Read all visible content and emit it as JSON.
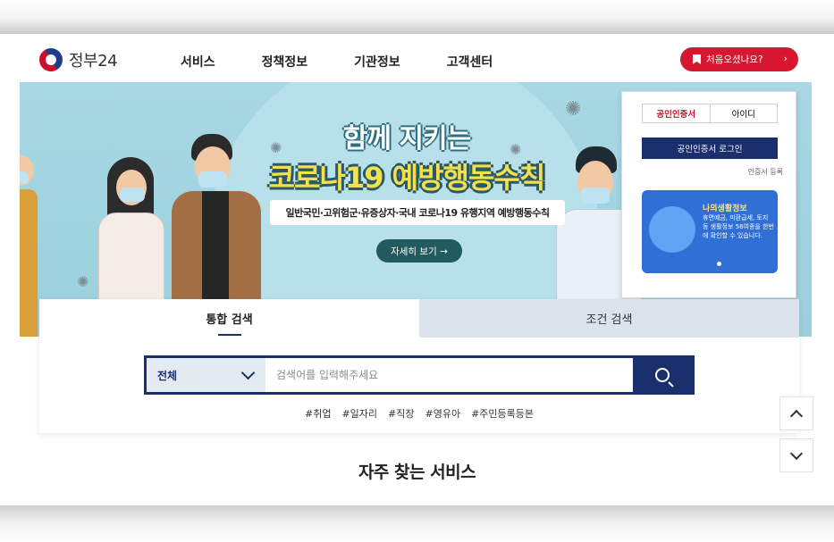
{
  "header": {
    "logo_text": "정부24",
    "nav": [
      "서비스",
      "정책정보",
      "기관정보",
      "고객센터"
    ],
    "first_visit_label": "처음오셨나요?",
    "first_visit_chevron": "›"
  },
  "banner": {
    "title_line1": "함께 지키는",
    "title_line2": "코로나19 예방행동수칙",
    "subtitle": "일반국민·고위험군·유증상자·국내 코로나19 유행지역 예방행동수칙",
    "detail_button": "자세히 보기 →"
  },
  "login": {
    "tabs": [
      "공인인증서",
      "아이디"
    ],
    "login_button": "공인인증서 로그인",
    "cert_register": "인증서 등록",
    "life_info_title": "나의생활정보",
    "life_info_desc": "휴면예금, 미환급세, 토지 등 생활정보 56여종을 한번에 확인할 수 있습니다."
  },
  "search": {
    "tabs": [
      "통합 검색",
      "조건 검색"
    ],
    "scope": "전체",
    "placeholder": "검색어를 입력해주세요",
    "hashtags": [
      "#취업",
      "#일자리",
      "#직장",
      "#영유아",
      "#주민등록등본"
    ]
  },
  "section_title": "자주 찾는 서비스",
  "colors": {
    "brand_navy": "#1a2f6b",
    "accent_red": "#d7172f",
    "banner_bg": "#a9d8e4"
  }
}
